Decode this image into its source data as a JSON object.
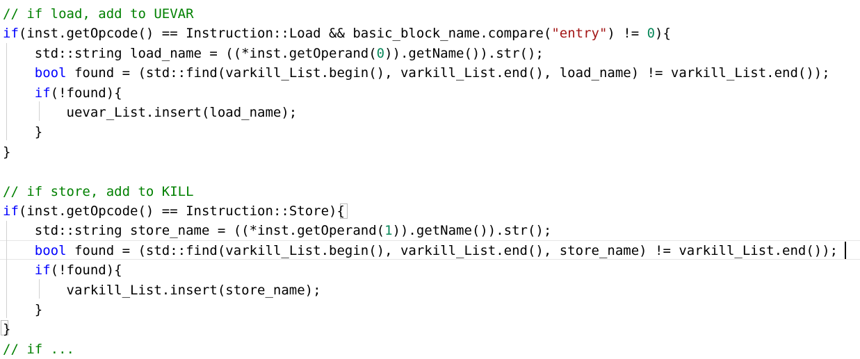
{
  "editor": {
    "lines": [
      [
        {
          "t": "comment",
          "v": "// if load, add to UEVAR"
        }
      ],
      [
        {
          "t": "keyword",
          "v": "if"
        },
        {
          "t": "plain",
          "v": "(inst.getOpcode() == Instruction::Load && basic_block_name.compare("
        },
        {
          "t": "string",
          "v": "\"entry\""
        },
        {
          "t": "plain",
          "v": ") != "
        },
        {
          "t": "number",
          "v": "0"
        },
        {
          "t": "plain",
          "v": "){"
        }
      ],
      [
        {
          "t": "plain",
          "v": "    std::string load_name = ((*inst.getOperand("
        },
        {
          "t": "number",
          "v": "0"
        },
        {
          "t": "plain",
          "v": ")).getName()).str();"
        }
      ],
      [
        {
          "t": "plain",
          "v": "    "
        },
        {
          "t": "keyword",
          "v": "bool"
        },
        {
          "t": "plain",
          "v": " found = (std::find(varkill_List.begin(), varkill_List.end(), load_name) != varkill_List.end());"
        }
      ],
      [
        {
          "t": "plain",
          "v": "    "
        },
        {
          "t": "keyword",
          "v": "if"
        },
        {
          "t": "plain",
          "v": "(!found){"
        }
      ],
      [
        {
          "t": "plain",
          "v": "        uevar_List.insert(load_name);"
        }
      ],
      [
        {
          "t": "plain",
          "v": "    }"
        }
      ],
      [
        {
          "t": "plain",
          "v": "}"
        }
      ],
      [
        {
          "t": "plain",
          "v": ""
        }
      ],
      [
        {
          "t": "comment",
          "v": "// if store, add to KILL"
        }
      ],
      [
        {
          "t": "keyword",
          "v": "if"
        },
        {
          "t": "plain",
          "v": "(inst.getOpcode() == Instruction::Store){"
        }
      ],
      [
        {
          "t": "plain",
          "v": "    std::string store_name = ((*inst.getOperand("
        },
        {
          "t": "number",
          "v": "1"
        },
        {
          "t": "plain",
          "v": ")).getName()).str();"
        }
      ],
      [
        {
          "t": "plain",
          "v": "    "
        },
        {
          "t": "keyword",
          "v": "bool"
        },
        {
          "t": "plain",
          "v": " found = (std::find(varkill_List.begin(), varkill_List.end(), store_name) != varkill_List.end());"
        }
      ],
      [
        {
          "t": "plain",
          "v": "    "
        },
        {
          "t": "keyword",
          "v": "if"
        },
        {
          "t": "plain",
          "v": "(!found){"
        }
      ],
      [
        {
          "t": "plain",
          "v": "        varkill_List.insert(store_name);"
        }
      ],
      [
        {
          "t": "plain",
          "v": "    }"
        }
      ],
      [
        {
          "t": "plain",
          "v": "}"
        }
      ],
      [
        {
          "t": "comment",
          "v": "// if ..."
        }
      ]
    ],
    "colors": {
      "comment": "#008000",
      "keyword": "#0000ff",
      "string": "#a31515",
      "number": "#09885a",
      "plain": "#000000"
    }
  }
}
